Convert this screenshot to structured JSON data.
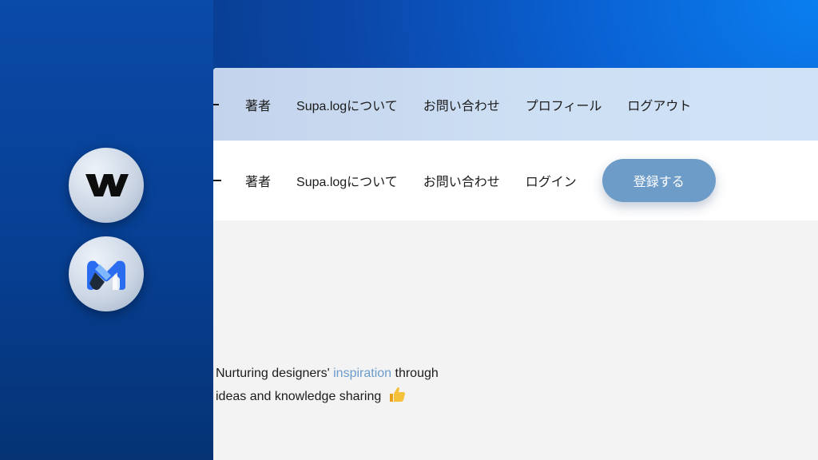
{
  "header_top": {
    "nav": [
      "著者",
      "Supa.logについて",
      "お問い合わせ",
      "プロフィール",
      "ログアウト"
    ]
  },
  "header_bottom": {
    "nav": [
      "著者",
      "Supa.logについて",
      "お問い合わせ",
      "ログイン"
    ],
    "signup_label": "登録する"
  },
  "hero": {
    "line1_before": "Nurturing designers' ",
    "line1_accent": "inspiration",
    "line1_after": " through",
    "line2": "ideas and knowledge sharing"
  },
  "logos": [
    "webflow-logo-icon",
    "memberstack-logo-icon"
  ],
  "colors": {
    "accent": "#6b9ccc",
    "button": "#6d9cc9",
    "background_blue": "#0a5fd0"
  }
}
